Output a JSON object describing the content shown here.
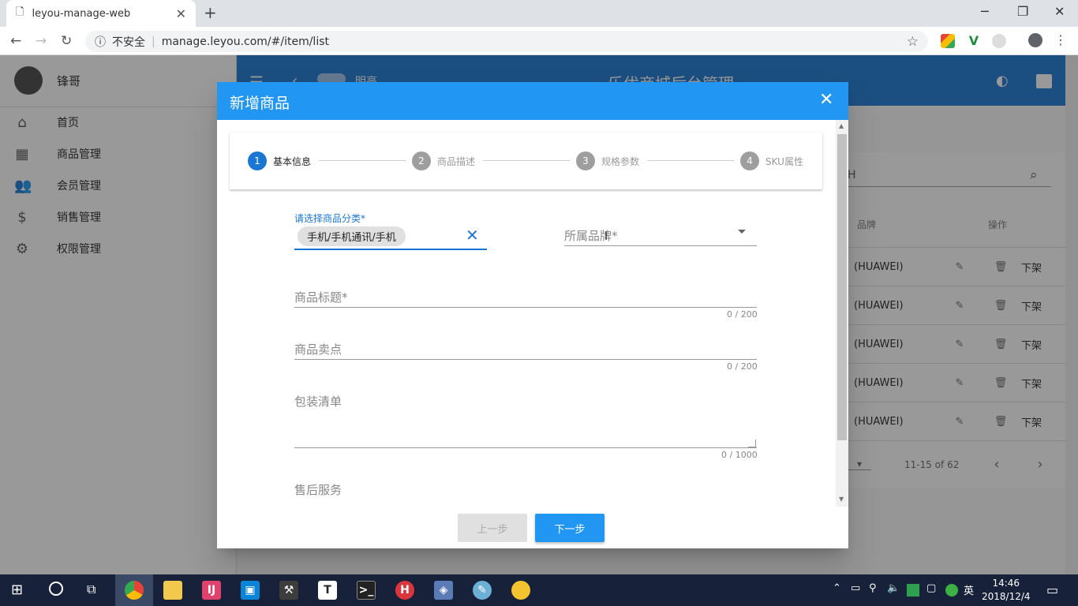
{
  "browser": {
    "tab_title": "leyou-manage-web",
    "security_label": "不安全",
    "url": "manage.leyou.com/#/item/list"
  },
  "sidebar": {
    "user_name": "锋哥",
    "items": [
      {
        "label": "首页",
        "icon": "home-icon"
      },
      {
        "label": "商品管理",
        "icon": "apps-icon"
      },
      {
        "label": "会员管理",
        "icon": "people-icon"
      },
      {
        "label": "销售管理",
        "icon": "dollar-icon"
      },
      {
        "label": "权限管理",
        "icon": "gear-icon"
      }
    ]
  },
  "appbar": {
    "title": "乐优商城后台管理",
    "toggle_label": "明亮"
  },
  "table": {
    "headers": {
      "brand": "品牌",
      "action": "操作"
    },
    "rows": [
      {
        "brand": "(HUAWEI)",
        "action": "下架"
      },
      {
        "brand": "(HUAWEI)",
        "action": "下架"
      },
      {
        "brand": "(HUAWEI)",
        "action": "下架"
      },
      {
        "brand": "(HUAWEI)",
        "action": "下架"
      },
      {
        "brand": "(HUAWEI)",
        "action": "下架"
      }
    ],
    "pagination": "11-15 of 62",
    "search_fragment": "H"
  },
  "dialog": {
    "title": "新增商品",
    "steps": [
      {
        "num": "1",
        "label": "基本信息"
      },
      {
        "num": "2",
        "label": "商品描述"
      },
      {
        "num": "3",
        "label": "规格参数"
      },
      {
        "num": "4",
        "label": "SKU属性"
      }
    ],
    "category": {
      "label": "请选择商品分类*",
      "value": "手机/手机通讯/手机"
    },
    "brand": {
      "placeholder": "所属品牌*"
    },
    "title_field": {
      "placeholder": "商品标题*",
      "counter": "0 / 200"
    },
    "subtitle_field": {
      "placeholder": "商品卖点",
      "counter": "0 / 200"
    },
    "packing_field": {
      "placeholder": "包装清单",
      "counter": "0 / 1000"
    },
    "service_field": {
      "placeholder": "售后服务"
    },
    "prev_button": "上一步",
    "next_button": "下一步"
  },
  "taskbar": {
    "time": "14:46",
    "date": "2018/12/4",
    "ime": "英"
  },
  "colors": {
    "primary": "#1976d2",
    "dialog_header": "#2196f3"
  }
}
